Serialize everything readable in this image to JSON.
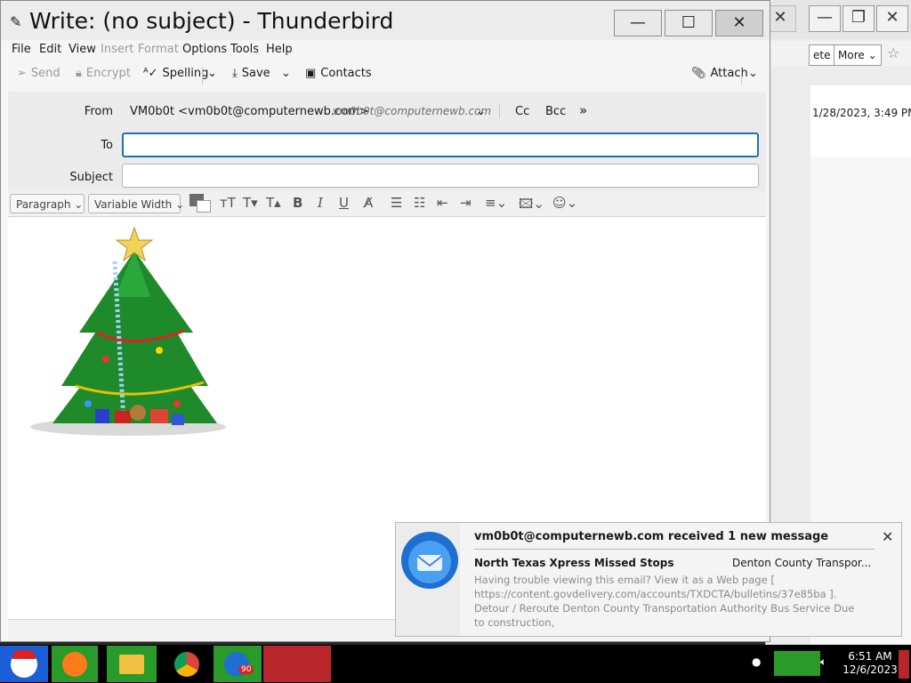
{
  "window": {
    "title": "Write: (no subject) - Thunderbird"
  },
  "menu": [
    "File",
    "Edit",
    "View",
    "Insert",
    "Format",
    "Options",
    "Tools",
    "Help"
  ],
  "toolbar": {
    "send": "Send",
    "encrypt": "Encrypt",
    "spelling": "Spelling",
    "save": "Save",
    "contacts": "Contacts",
    "attach": "Attach"
  },
  "header": {
    "from_label": "From",
    "from_value": "VM0b0t <vm0b0t@computernewb.com>",
    "from_alt": "vm0b0t@computernewb.com",
    "cc": "Cc",
    "bcc": "Bcc",
    "to_label": "To",
    "to_value": "",
    "subject_label": "Subject",
    "subject_value": ""
  },
  "format": {
    "paragraph": "Paragraph",
    "font": "Variable Width"
  },
  "background_window": {
    "toolbar_partial": "ete",
    "more": "More",
    "date": "1/28/2023, 3:49 PM"
  },
  "notification": {
    "title": "vm0b0t@computernewb.com received 1 new message",
    "subject": "North Texas Xpress Missed Stops",
    "sender": "Denton County Transpor...",
    "preview": "Having trouble viewing this email? View it as a Web page [ https://content.govdelivery.com/accounts/TXDCTA/bulletins/37e85ba ]. Detour / Reroute Denton County Transportation Authority Bus Service Due to construction,"
  },
  "taskbar": {
    "time": "6:51 AM",
    "date": "12/6/2023",
    "badge": "90"
  }
}
